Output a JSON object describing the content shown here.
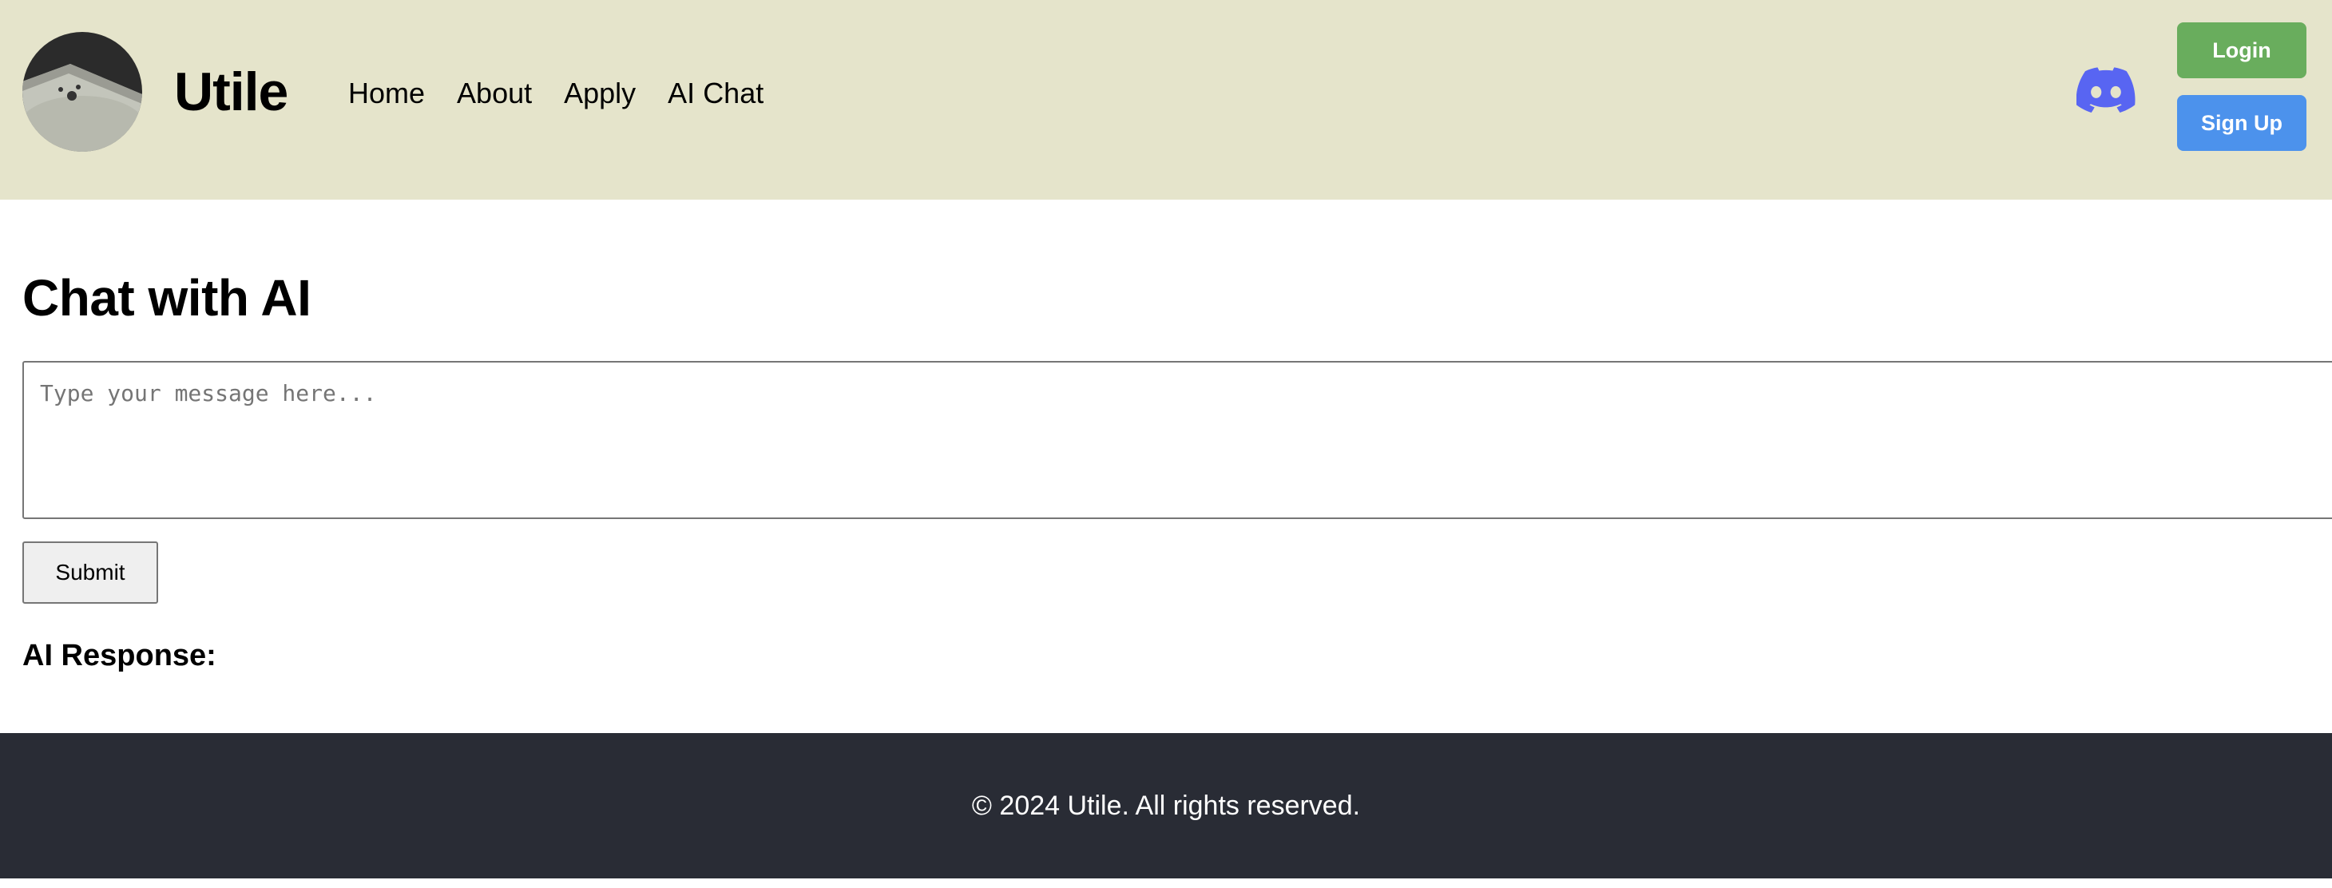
{
  "header": {
    "brand": "Utile",
    "nav": [
      {
        "label": "Home"
      },
      {
        "label": "About"
      },
      {
        "label": "Apply"
      },
      {
        "label": "AI Chat"
      }
    ],
    "discord_icon": "discord-icon",
    "login_label": "Login",
    "signup_label": "Sign Up"
  },
  "main": {
    "title": "Chat with AI",
    "message_input": {
      "value": "",
      "placeholder": "Type your message here..."
    },
    "submit_label": "Submit",
    "response_label": "AI Response:"
  },
  "footer": {
    "text": "© 2024 Utile. All rights reserved."
  },
  "colors": {
    "header_bg": "#e5e4cb",
    "login_button": "#69ad5d",
    "signup_button": "#4c92ec",
    "discord": "#5865f2",
    "footer_bg": "#292c35"
  }
}
